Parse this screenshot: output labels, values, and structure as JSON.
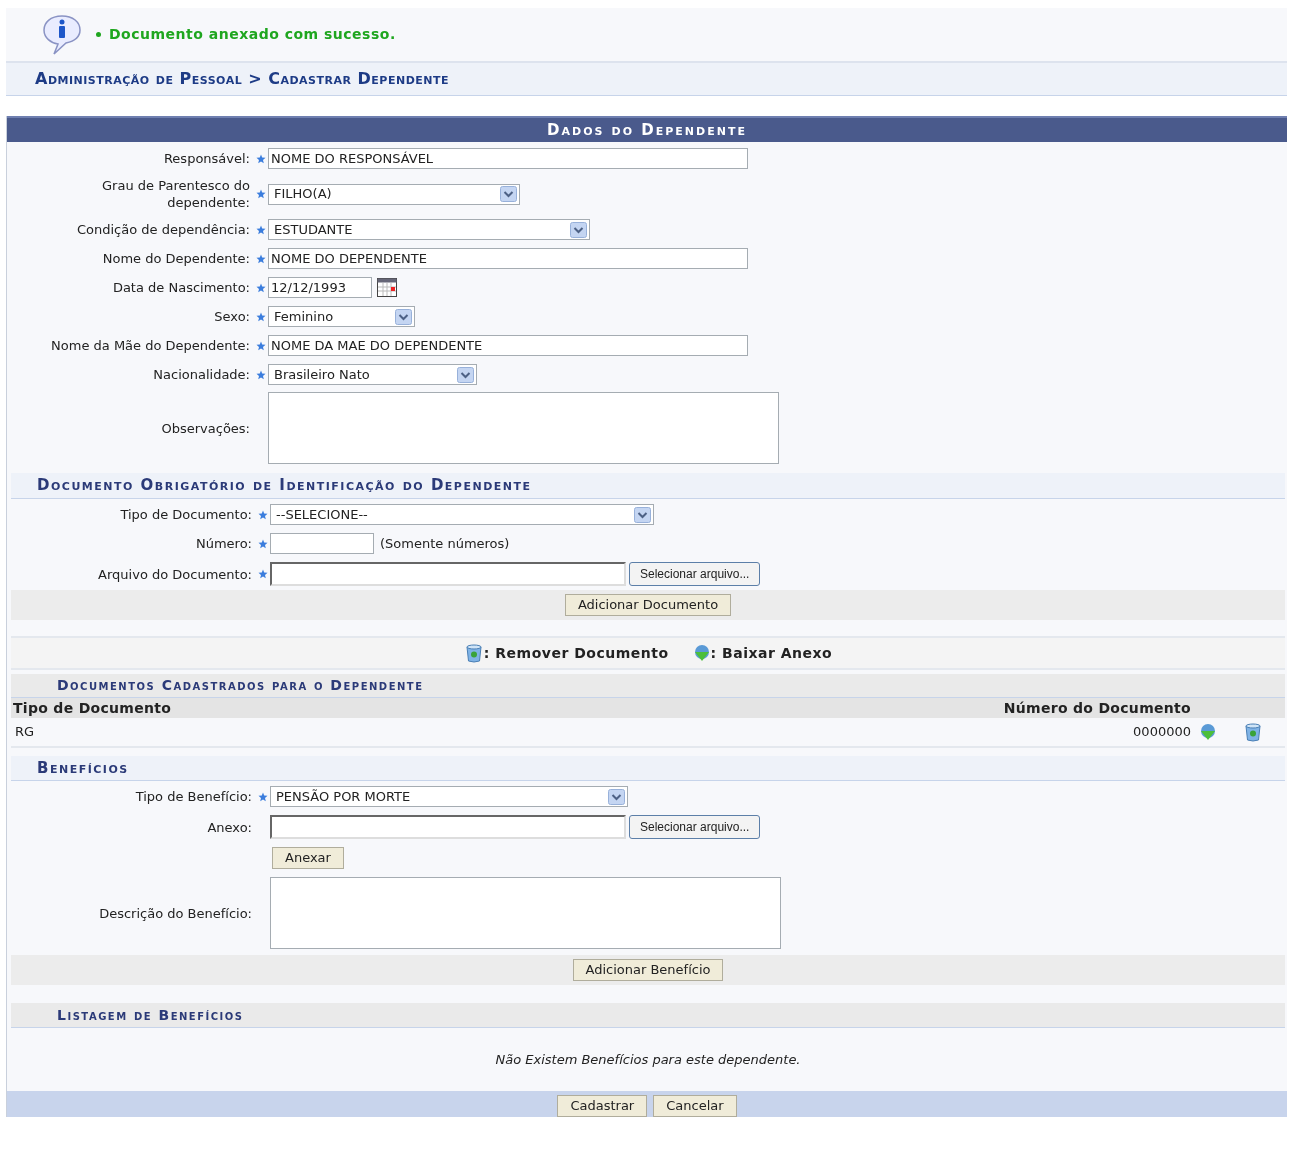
{
  "message": "Documento anexado com sucesso.",
  "breadcrumb": "Administração de Pessoal > Cadastrar Dependente",
  "section_title": "Dados do Dependente",
  "fields": [
    {
      "label": "Responsável:",
      "required": true,
      "kind": "text",
      "value": "NOME DO RESPONSÁVEL"
    },
    {
      "label": "Grau de Parentesco do dependente:",
      "required": true,
      "kind": "select",
      "value": "FILHO(A)"
    },
    {
      "label": "Condição de dependência:",
      "required": true,
      "kind": "select",
      "value": "ESTUDANTE"
    },
    {
      "label": "Nome do Dependente:",
      "required": true,
      "kind": "text",
      "value": "NOME DO DEPENDENTE"
    },
    {
      "label": "Data de Nascimento:",
      "required": true,
      "kind": "date",
      "value": "12/12/1993"
    },
    {
      "label": "Sexo:",
      "required": true,
      "kind": "select",
      "value": "Feminino"
    },
    {
      "label": "Nome da Mãe do Dependente:",
      "required": true,
      "kind": "text",
      "value": "NOME DA MAE DO DEPENDENTE"
    },
    {
      "label": "Nacionalidade:",
      "required": true,
      "kind": "select",
      "value": "Brasileiro Nato"
    },
    {
      "label": "Observações:",
      "required": false,
      "kind": "textarea"
    }
  ],
  "document_section": {
    "title": "Documento Obrigatório de Identificação do Dependente",
    "fields": [
      {
        "label": "Tipo de Documento:",
        "required": true,
        "kind": "select",
        "value": "--SELECIONE--"
      },
      {
        "label": "Número:",
        "required": true,
        "kind": "text",
        "hint": "(Somente números)"
      },
      {
        "label": "Arquivo do Documento:",
        "required": true,
        "kind": "file",
        "button": "Selecionar arquivo..."
      }
    ],
    "add_button": "Adicionar Documento"
  },
  "legend": [
    {
      "kind": "remove",
      "text": ": Remover Documento"
    },
    {
      "kind": "download",
      "text": ": Baixar Anexo"
    }
  ],
  "documents": {
    "title": "Documentos Cadastrados para o Dependente",
    "columns": [
      "Tipo de Documento",
      "Número do Documento"
    ],
    "rows": [
      {
        "type": "RG",
        "number": "0000000"
      }
    ]
  },
  "benefits": {
    "title": "Benefícios",
    "fields": [
      {
        "label": "Tipo de Benefício:",
        "required": true,
        "kind": "select",
        "value": "PENSÃO POR MORTE"
      },
      {
        "label": "Anexo:",
        "required": false,
        "kind": "file",
        "button": "Selecionar arquivo..."
      },
      {
        "kind": "button",
        "button": "Anexar"
      },
      {
        "label": "Descrição do Benefício:",
        "required": false,
        "kind": "textarea"
      }
    ],
    "add_button": "Adicionar Benefício"
  },
  "benefit_list": {
    "title": "Listagem de Benefícios",
    "empty": "Não Existem Benefícios para este dependente."
  },
  "actions": [
    "Cadastrar",
    "Cancelar"
  ]
}
